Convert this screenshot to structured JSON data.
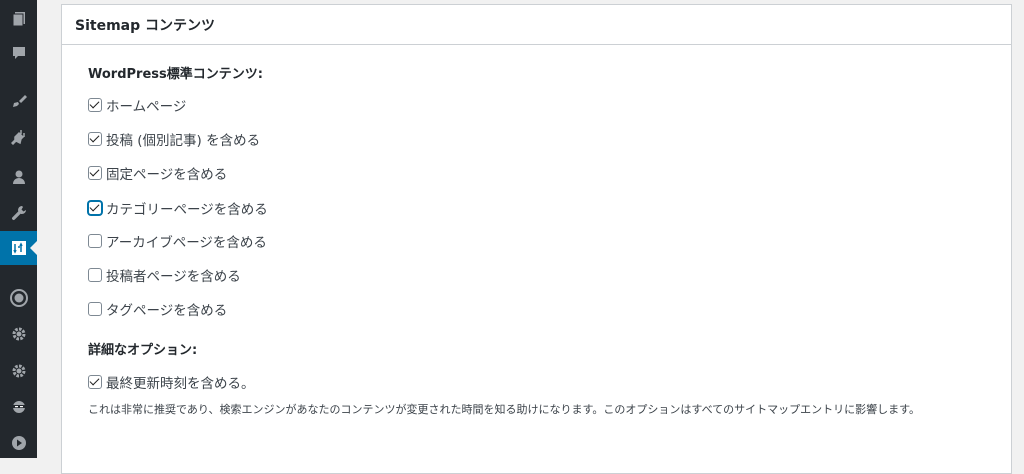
{
  "sidebar": {
    "icons": [
      "pages-icon",
      "comments-icon",
      "appearance-icon",
      "plugins-icon",
      "users-icon",
      "tools-icon",
      "sitemap-plugin-icon",
      "wordpress-icon",
      "settings-icon",
      "settings-icon",
      "ninja-icon",
      "play-icon"
    ],
    "active_index": 6,
    "active_color": "#0073aa"
  },
  "panel": {
    "title": "Sitemap コンテンツ"
  },
  "standard": {
    "heading": "WordPress標準コンテンツ:",
    "items": [
      {
        "label": "ホームページ",
        "checked": true
      },
      {
        "label": "投稿 (個別記事) を含める",
        "checked": true
      },
      {
        "label": "固定ページを含める",
        "checked": true
      },
      {
        "label": "カテゴリーページを含める",
        "checked": true,
        "focused": true
      },
      {
        "label": "アーカイブページを含める",
        "checked": false
      },
      {
        "label": "投稿者ページを含める",
        "checked": false
      },
      {
        "label": "タグページを含める",
        "checked": false
      }
    ]
  },
  "detail": {
    "heading": "詳細なオプション:",
    "items": [
      {
        "label": "最終更新時刻を含める。",
        "checked": true
      }
    ],
    "description": "これは非常に推奨であり、検索エンジンがあなたのコンテンツが変更された時間を知る助けになります。このオプションはすべてのサイトマップエントリに影響します。"
  }
}
